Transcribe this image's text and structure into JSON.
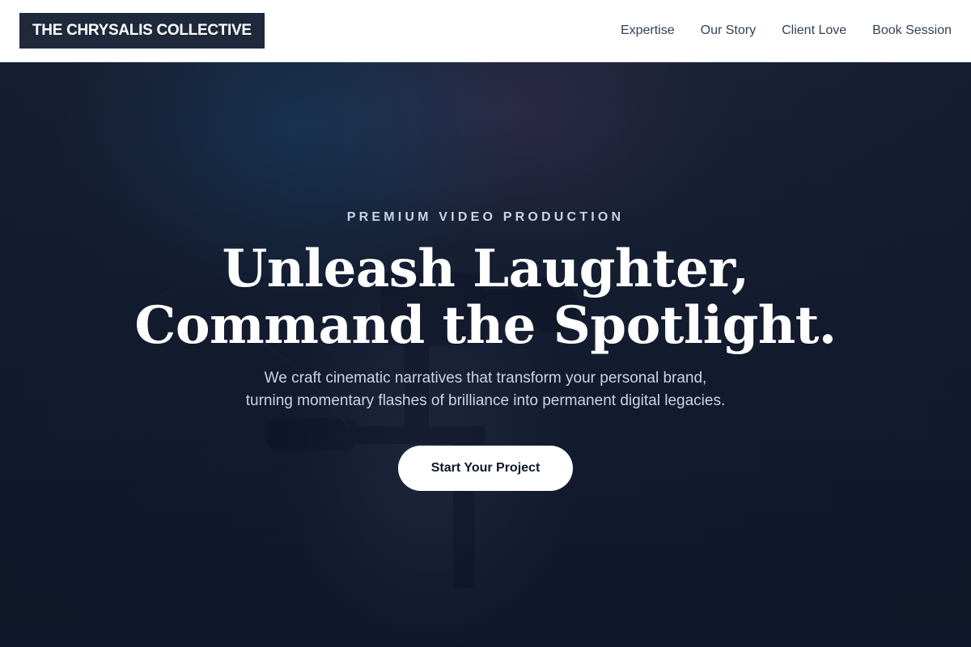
{
  "header": {
    "logo_text": "THE CHRYSALIS COLLECTIVE",
    "nav": [
      {
        "label": "Expertise"
      },
      {
        "label": "Our Story"
      },
      {
        "label": "Client Love"
      },
      {
        "label": "Book Session"
      }
    ]
  },
  "hero": {
    "eyebrow": "PREMIUM VIDEO PRODUCTION",
    "headline_line1": "Unleash Laughter,",
    "headline_line2": "Command the Spotlight.",
    "subtext_line1": "We craft cinematic narratives that transform your personal brand,",
    "subtext_line2": "turning momentary flashes of brilliance into permanent digital legacies.",
    "cta_label": "Start Your Project",
    "background_image": "camera-rig-background"
  },
  "colors": {
    "header_bg": "#ffffff",
    "logo_bg": "#1e293b",
    "hero_bg": "#0f172a",
    "nav_text": "#334155",
    "cta_bg": "#ffffff"
  }
}
